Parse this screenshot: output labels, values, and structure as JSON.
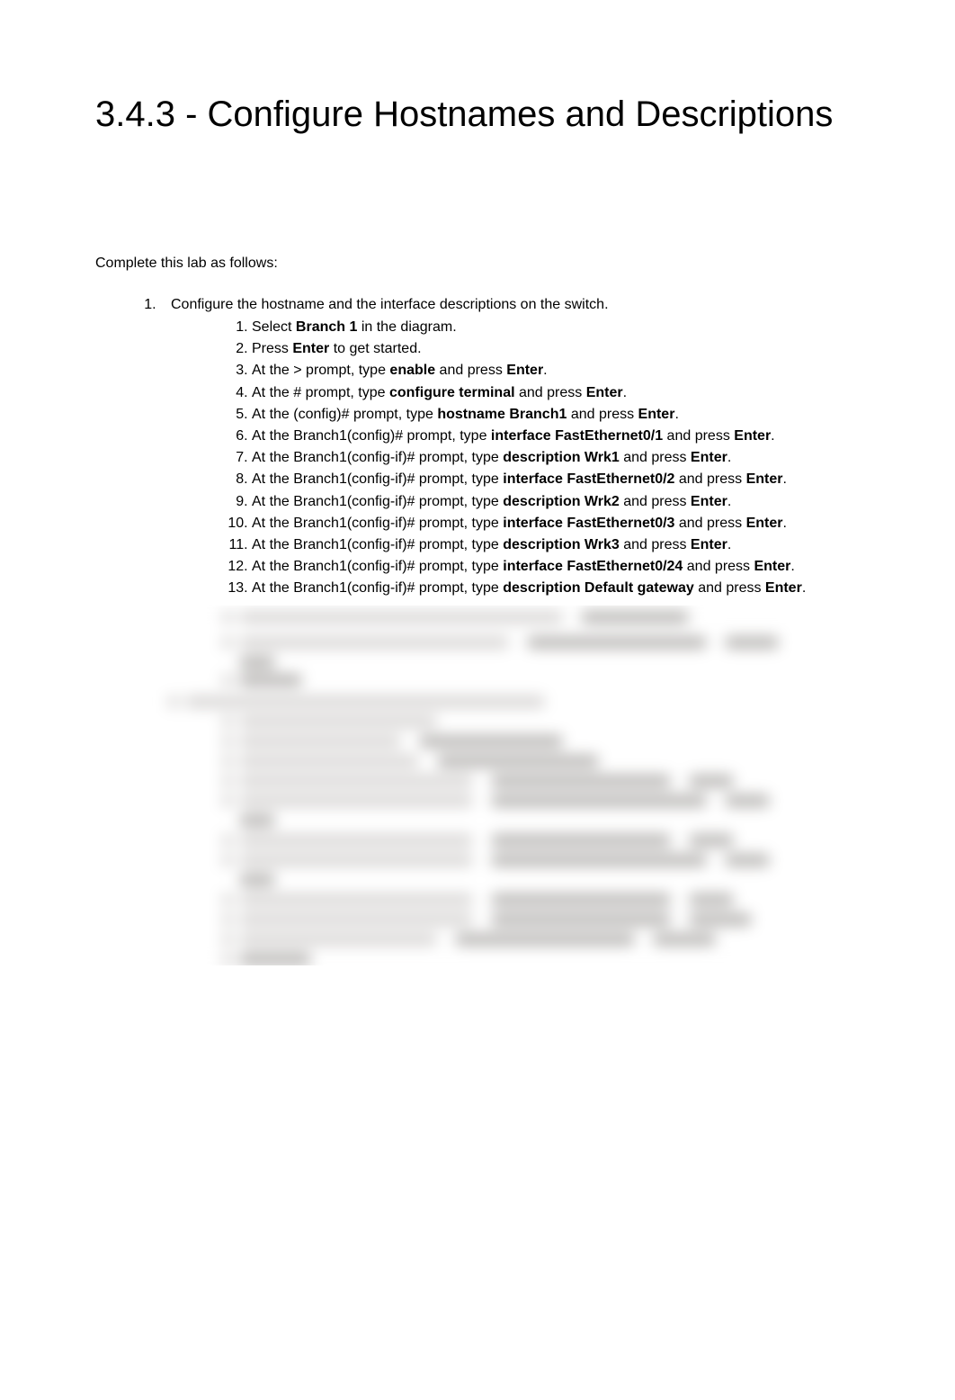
{
  "title": "3.4.3 - Configure Hostnames and Descriptions",
  "intro": "Complete this lab as follows:",
  "step1": {
    "lead": "Configure the hostname and the interface descriptions on the switch.",
    "items": [
      {
        "pre": "Select ",
        "bold1": "Branch 1",
        "mid": " in the diagram.",
        "bold2": "",
        "post": ""
      },
      {
        "pre": "Press ",
        "bold1": "Enter",
        "mid": " to get started.",
        "bold2": "",
        "post": ""
      },
      {
        "pre": "At the > prompt, type ",
        "bold1": "enable",
        "mid": " and press ",
        "bold2": "Enter",
        "post": "."
      },
      {
        "pre": "At the # prompt, type ",
        "bold1": "configure terminal",
        "mid": " and press ",
        "bold2": "Enter",
        "post": "."
      },
      {
        "pre": "At the (config)# prompt, type ",
        "bold1": "hostname Branch1",
        "mid": " and press ",
        "bold2": "Enter",
        "post": "."
      },
      {
        "pre": "At the Branch1(config)# prompt, type ",
        "bold1": "interface FastEthernet0/1",
        "mid": " and press ",
        "bold2": "Enter",
        "post": "."
      },
      {
        "pre": "At the Branch1(config-if)# prompt, type ",
        "bold1": "description Wrk1",
        "mid": " and press ",
        "bold2": "Enter",
        "post": "."
      },
      {
        "pre": "At the Branch1(config-if)# prompt, type ",
        "bold1": "interface FastEthernet0/2",
        "mid": " and press ",
        "bold2": "Enter",
        "post": "."
      },
      {
        "pre": "At the Branch1(config-if)# prompt, type ",
        "bold1": "description Wrk2",
        "mid": " and press ",
        "bold2": "Enter",
        "post": "."
      },
      {
        "pre": "At the Branch1(config-if)# prompt, type ",
        "bold1": "interface FastEthernet0/3",
        "mid": " and press ",
        "bold2": "Enter",
        "post": "."
      },
      {
        "pre": "At the Branch1(config-if)# prompt, type ",
        "bold1": "description Wrk3",
        "mid": " and press ",
        "bold2": "Enter",
        "post": "."
      },
      {
        "pre": "At the Branch1(config-if)# prompt, type ",
        "bold1": "interface FastEthernet0/24",
        "mid": " and press ",
        "bold2": "Enter",
        "post": "."
      },
      {
        "pre": "At the Branch1(config-if)# prompt, type ",
        "bold1": "description Default gateway",
        "mid": " and press ",
        "bold2": "Enter",
        "post": "."
      }
    ]
  }
}
